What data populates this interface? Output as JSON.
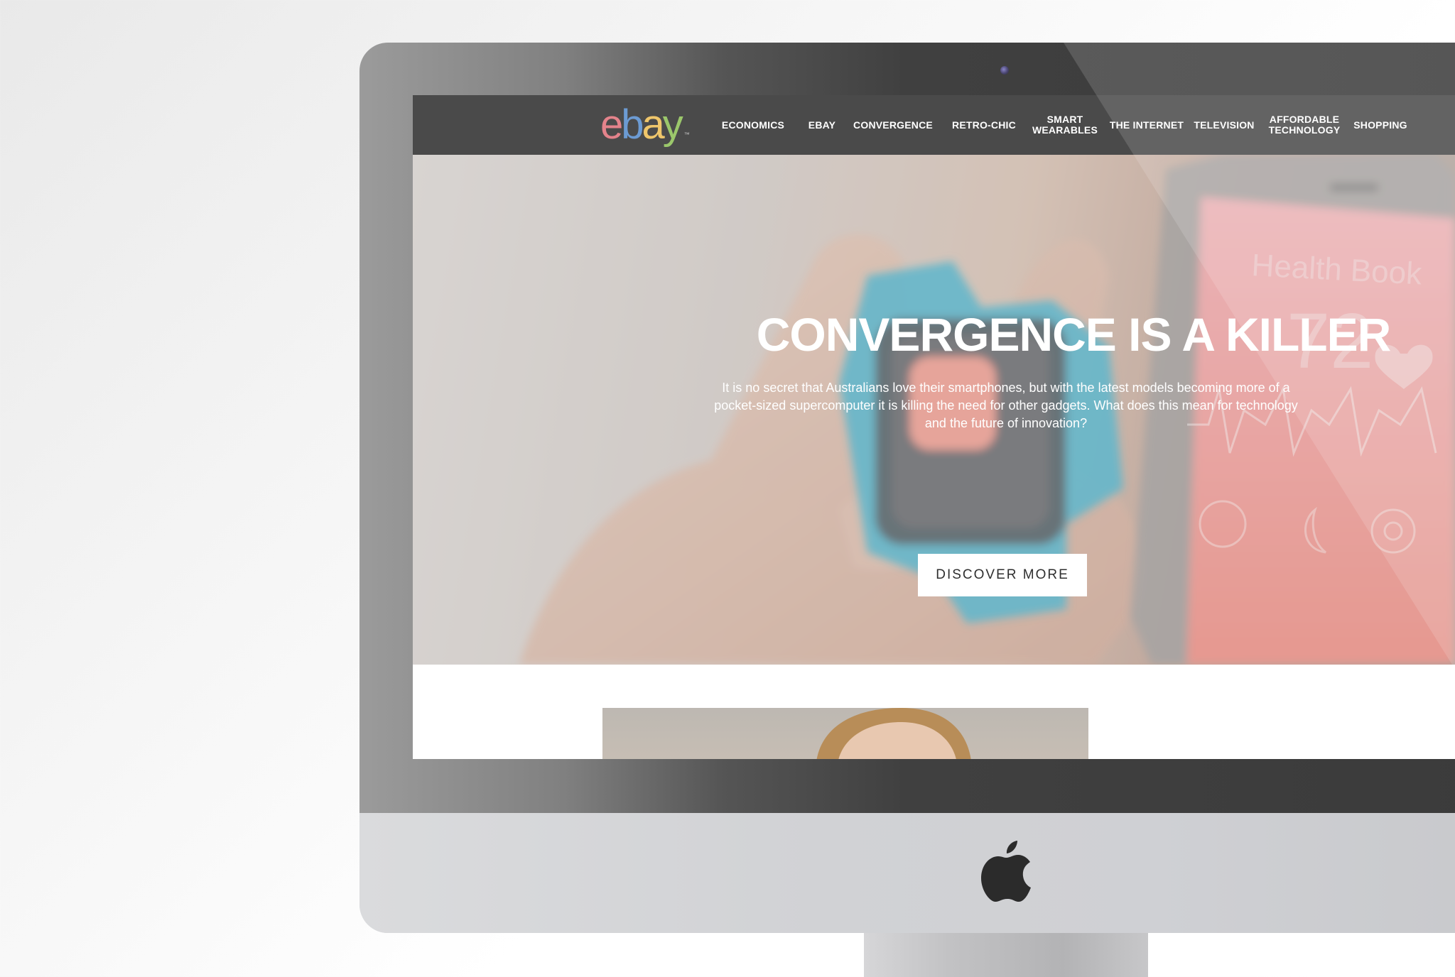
{
  "brand": {
    "logo_letters": [
      "e",
      "b",
      "a",
      "y"
    ],
    "logo_colors": [
      "#e4838b",
      "#6c9bd3",
      "#efc66b",
      "#9bc76b"
    ],
    "trademark": "™"
  },
  "nav": {
    "items": [
      {
        "label": "ECONOMICS"
      },
      {
        "label": "EBAY"
      },
      {
        "label": "CONVERGENCE"
      },
      {
        "label": "RETRO-CHIC"
      },
      {
        "label": "SMART WEARABLES"
      },
      {
        "label": "THE INTERNET"
      },
      {
        "label": "TELEVISION"
      },
      {
        "label": "AFFORDABLE TECHNOLOGY"
      },
      {
        "label": "SHOPPING"
      }
    ]
  },
  "hero": {
    "title": "CONVERGENCE IS A KILLER",
    "text": "It is no secret that Australians love their smartphones, but with the latest models becoming more of a pocket-sized supercomputer it is killing the need for other gadgets. What does this mean for technology and the future of innovation?",
    "cta_label": "DISCOVER MORE",
    "phone_app_title": "Health Book",
    "phone_reading": "72"
  },
  "colors": {
    "nav_bg": "#4a4a4a",
    "watch_band": "#2aa9c9",
    "phone_screen": "#f08a86",
    "cta_bg": "#ffffff"
  },
  "icons": [
    "apple-logo-icon",
    "heart-icon",
    "moon-icon",
    "target-icon",
    "dumbbell-icon",
    "heartbeat-icon"
  ]
}
